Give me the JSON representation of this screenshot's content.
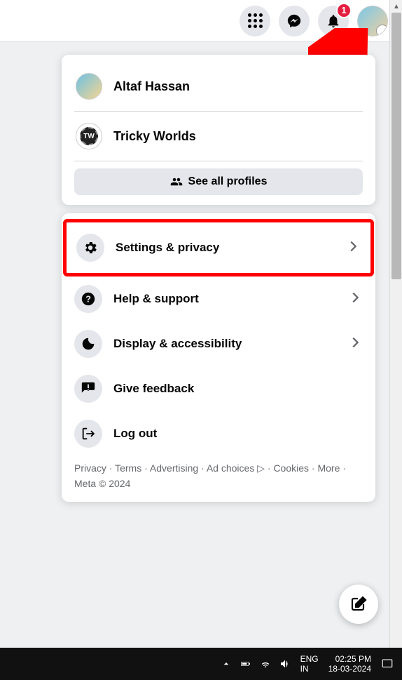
{
  "topbar": {
    "notification_badge": "1"
  },
  "profiles": {
    "items": [
      {
        "name": "Altaf Hassan"
      },
      {
        "name": "Tricky Worlds"
      }
    ],
    "see_all_label": "See all profiles"
  },
  "menu": {
    "settings_label": "Settings & privacy",
    "help_label": "Help & support",
    "display_label": "Display & accessibility",
    "feedback_label": "Give feedback",
    "logout_label": "Log out"
  },
  "footer": {
    "privacy": "Privacy",
    "terms": "Terms",
    "advertising": "Advertising",
    "adchoices": "Ad choices",
    "cookies": "Cookies",
    "more": "More",
    "meta": "Meta © 2024"
  },
  "taskbar": {
    "lang1": "ENG",
    "lang2": "IN",
    "time": "02:25 PM",
    "date": "18-03-2024"
  }
}
